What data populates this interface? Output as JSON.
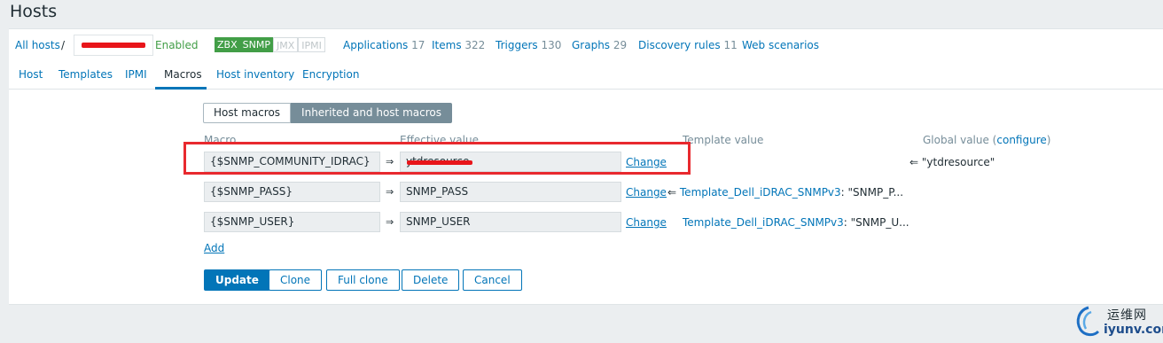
{
  "page": {
    "title": "Hosts"
  },
  "host_nav": {
    "all_hosts": "All hosts",
    "separator": "/",
    "status": "Enabled",
    "badges": {
      "zbx": "ZBX",
      "snmp": "SNMP",
      "jmx": "JMX",
      "ipmi": "IPMI"
    },
    "applications": {
      "label": "Applications",
      "count": "17"
    },
    "items": {
      "label": "Items",
      "count": "322"
    },
    "triggers": {
      "label": "Triggers",
      "count": "130"
    },
    "graphs": {
      "label": "Graphs",
      "count": "29"
    },
    "discovery": {
      "label": "Discovery rules",
      "count": "11"
    },
    "web": {
      "label": "Web scenarios"
    }
  },
  "tabs": [
    "Host",
    "Templates",
    "IPMI",
    "Macros",
    "Host inventory",
    "Encryption"
  ],
  "macros": {
    "toggle": {
      "host": "Host macros",
      "inherited": "Inherited and host macros"
    },
    "columns": {
      "macro": "Macro",
      "effective": "Effective value",
      "template": "Template value",
      "global": "Global value (",
      "configure": "configure",
      "global_close": ")"
    },
    "rows": [
      {
        "macro": "{$SNMP_COMMUNITY_IDRAC}",
        "value": "ytdresource",
        "change": "Change",
        "template_link": "",
        "template_value": "",
        "global": "\"ytdresource\""
      },
      {
        "macro": "{$SNMP_PASS}",
        "value": "SNMP_PASS",
        "change": "Change",
        "template_link": "Template_Dell_iDRAC_SNMPv3",
        "template_value": ": \"SNMP_P...",
        "global": ""
      },
      {
        "macro": "{$SNMP_USER}",
        "value": "SNMP_USER",
        "change": "Change",
        "template_link": "Template_Dell_iDRAC_SNMPv3",
        "template_value": ": \"SNMP_U...",
        "global": ""
      }
    ],
    "arrow": "⇒",
    "back_arrow": "⇐",
    "add": "Add"
  },
  "buttons": {
    "update": "Update",
    "clone": "Clone",
    "full_clone": "Full clone",
    "delete": "Delete",
    "cancel": "Cancel"
  },
  "watermark": {
    "cn": "运维网",
    "en": "iyunv.com"
  },
  "colors": {
    "link": "#0275b8",
    "enabled": "#429e47",
    "annotation": "#e8292e"
  }
}
